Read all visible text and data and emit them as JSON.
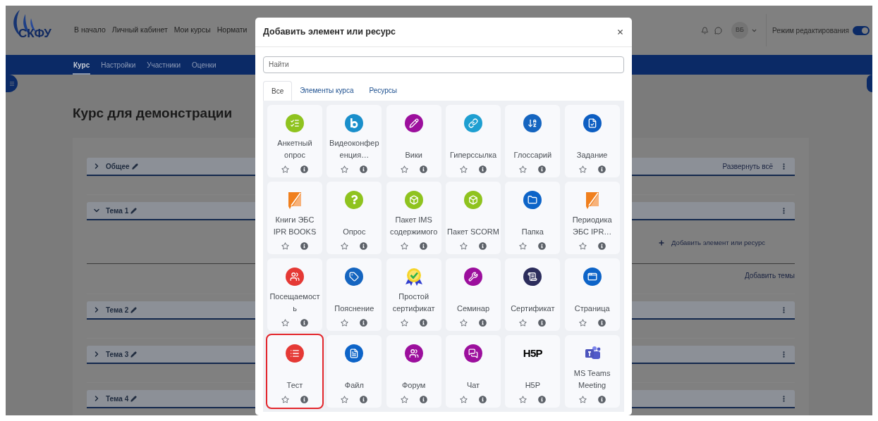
{
  "header": {
    "logo_text": "СКФУ",
    "nav": [
      "В начало",
      "Личный кабинет",
      "Мои курсы",
      "Нормати"
    ],
    "user_initials": "ВБ",
    "edit_mode": {
      "label": "Режим редактирования",
      "on": true
    }
  },
  "course_nav": [
    {
      "label": "Курс",
      "selected": true
    },
    {
      "label": "Настройки",
      "selected": false
    },
    {
      "label": "Участники",
      "selected": false
    },
    {
      "label": "Оценки",
      "selected": false
    }
  ],
  "course": {
    "title": "Курс для демонстрации",
    "sections": [
      {
        "kind": "section",
        "title": "Общее",
        "expanded": false,
        "expand_all": "Развернуть всё"
      },
      {
        "kind": "section",
        "title": "Тема 1",
        "expanded": true,
        "add_activity": "Добавить элемент или ресурс"
      },
      {
        "kind": "add_sections",
        "label": "Добавить темы"
      },
      {
        "kind": "section",
        "title": "Тема 2",
        "expanded": false
      },
      {
        "kind": "section",
        "title": "Тема 3",
        "expanded": false
      },
      {
        "kind": "section",
        "title": "Тема 4",
        "expanded": false
      }
    ]
  },
  "modal": {
    "title": "Добавить элемент или ресурс",
    "search_placeholder": "Найти",
    "tabs": [
      {
        "label": "Все",
        "selected": true
      },
      {
        "label": "Элементы курса",
        "selected": false
      },
      {
        "label": "Ресурсы",
        "selected": false
      }
    ],
    "items": [
      {
        "name": "Анкетный опрос",
        "kind": "survey",
        "starred": false,
        "highlighted": false
      },
      {
        "name": "Видеоконференция…",
        "kind": "videoconference",
        "starred": false,
        "highlighted": false
      },
      {
        "name": "Вики",
        "kind": "wiki",
        "starred": false,
        "highlighted": false
      },
      {
        "name": "Гиперссылка",
        "kind": "url",
        "starred": false,
        "highlighted": false
      },
      {
        "name": "Глоссарий",
        "kind": "glossary",
        "starred": false,
        "highlighted": false
      },
      {
        "name": "Задание",
        "kind": "assign",
        "starred": false,
        "highlighted": false
      },
      {
        "name": "Книги ЭБС IPR BOOKS",
        "kind": "ipr",
        "starred": false,
        "highlighted": false
      },
      {
        "name": "Опрос",
        "kind": "feedback",
        "starred": false,
        "highlighted": false
      },
      {
        "name": "Пакет IMS содержимого",
        "kind": "package",
        "starred": false,
        "highlighted": false
      },
      {
        "name": "Пакет SCORM",
        "kind": "package",
        "starred": false,
        "highlighted": false
      },
      {
        "name": "Папка",
        "kind": "folder",
        "starred": false,
        "highlighted": false
      },
      {
        "name": "Периодика ЭБС IPR…",
        "kind": "ipr",
        "starred": false,
        "highlighted": false
      },
      {
        "name": "Посещаемость",
        "kind": "attendance",
        "starred": false,
        "highlighted": false
      },
      {
        "name": "Пояснение",
        "kind": "label",
        "starred": false,
        "highlighted": false
      },
      {
        "name": "Простой сертификат",
        "kind": "award",
        "starred": false,
        "highlighted": false
      },
      {
        "name": "Семинар",
        "kind": "workshop",
        "starred": false,
        "highlighted": false
      },
      {
        "name": "Сертификат",
        "kind": "certificate",
        "starred": false,
        "highlighted": false
      },
      {
        "name": "Страница",
        "kind": "page",
        "starred": false,
        "highlighted": false
      },
      {
        "name": "Тест",
        "kind": "quiz",
        "starred": false,
        "highlighted": true
      },
      {
        "name": "Файл",
        "kind": "file",
        "starred": false,
        "highlighted": false
      },
      {
        "name": "Форум",
        "kind": "forum",
        "starred": false,
        "highlighted": false
      },
      {
        "name": "Чат",
        "kind": "chat",
        "starred": false,
        "highlighted": false
      },
      {
        "name": "H5P",
        "kind": "textlogo",
        "logo_text": "H5P",
        "starred": false,
        "highlighted": false
      },
      {
        "name": "MS Teams Meeting",
        "kind": "teams",
        "starred": false,
        "highlighted": false
      }
    ]
  }
}
